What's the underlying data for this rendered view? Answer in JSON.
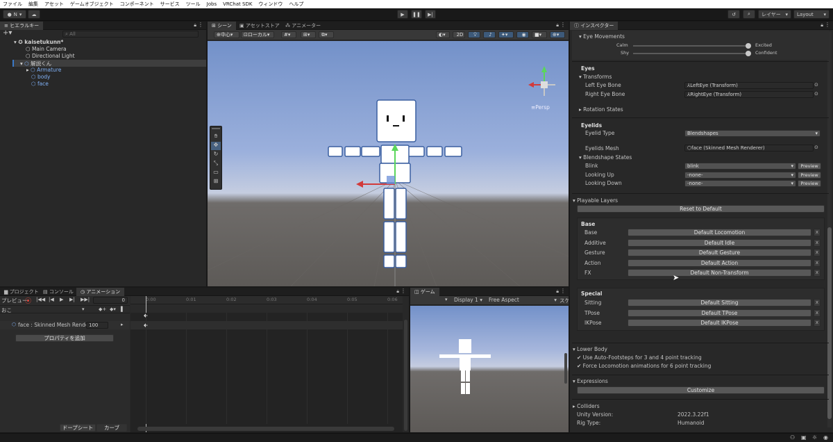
{
  "menubar": {
    "items": [
      "ファイル",
      "編集",
      "アセット",
      "ゲームオブジェクト",
      "コンポーネント",
      "サービス",
      "ツール",
      "Jobs",
      "VRChat SDK",
      "ウィンドウ",
      "ヘルプ"
    ]
  },
  "toolbar": {
    "account_label": "N",
    "layers_label": "レイヤー",
    "layout_label": "Layout"
  },
  "hierarchy": {
    "tab": "ヒエラルキー",
    "search_placeholder": "All",
    "items": [
      "kaisetukunn*",
      "Main Camera",
      "Directional Light",
      "解説くん",
      "Armature",
      "body",
      "face"
    ]
  },
  "scene": {
    "tabs": [
      "シーン",
      "アセットストア",
      "アニメーター"
    ],
    "pivot_label": "中心",
    "space_label": "ローカル",
    "mode_2d": "2D",
    "persp_label": "Persp"
  },
  "animation": {
    "tabs": [
      "プロジェクト",
      "コンソール",
      "アニメーション"
    ],
    "preview_label": "プレビュー",
    "frame_value": "0",
    "clip_name": "おこ",
    "property_label": "face : Skinned Mesh Rende",
    "property_value": "100",
    "add_property_label": "プロパティを追加",
    "ruler": [
      "0:00",
      "0:01",
      "0:02",
      "0:03",
      "0:04",
      "0:05",
      "0:06"
    ],
    "dopesheet_label": "ドープシート",
    "curves_label": "カーブ"
  },
  "game": {
    "tab": "ゲーム",
    "display_label": "Display 1",
    "aspect_label": "Free Aspect",
    "scale_label": "スケ"
  },
  "inspector": {
    "tab": "インスペクター",
    "eye_movements_label": "Eye Movements",
    "sliders": [
      {
        "left": "Calm",
        "right": "Excited",
        "value": 1.0
      },
      {
        "left": "Shy",
        "right": "Confident",
        "value": 1.0
      }
    ],
    "eyes_header": "Eyes",
    "transforms_label": "Transforms",
    "left_eye_label": "Left Eye Bone",
    "left_eye_value": "LeftEye (Transform)",
    "right_eye_label": "Right Eye Bone",
    "right_eye_value": "RightEye (Transform)",
    "rotation_states_label": "Rotation States",
    "eyelids_header": "Eyelids",
    "eyelid_type_label": "Eyelid Type",
    "eyelid_type_value": "Blendshapes",
    "eyelids_mesh_label": "Eyelids Mesh",
    "eyelids_mesh_value": "face (Skinned Mesh Renderer)",
    "blendshape_states_label": "Blendshape States",
    "blend_rows": [
      {
        "label": "Blink",
        "value": "blink",
        "button": "Preview"
      },
      {
        "label": "Looking Up",
        "value": "-none-",
        "button": "Preview"
      },
      {
        "label": "Looking Down",
        "value": "-none-",
        "button": "Preview"
      }
    ],
    "playable_layers_label": "Playable Layers",
    "reset_label": "Reset to Default",
    "base_header": "Base",
    "base_layers": [
      {
        "label": "Base",
        "value": "Default Locomotion"
      },
      {
        "label": "Additive",
        "value": "Default Idle"
      },
      {
        "label": "Gesture",
        "value": "Default Gesture"
      },
      {
        "label": "Action",
        "value": "Default Action"
      },
      {
        "label": "FX",
        "value": "Default Non-Transform"
      }
    ],
    "special_header": "Special",
    "special_layers": [
      {
        "label": "Sitting",
        "value": "Default Sitting"
      },
      {
        "label": "TPose",
        "value": "Default TPose"
      },
      {
        "label": "IKPose",
        "value": "Default IKPose"
      }
    ],
    "x_label": "x",
    "lower_body_label": "Lower Body",
    "check1_label": "Use Auto-Footsteps for 3 and 4 point tracking",
    "check2_label": "Force Locomotion animations for 6 point tracking",
    "expressions_label": "Expressions",
    "customize_label": "Customize",
    "colliders_label": "Colliders",
    "unity_version_label": "Unity Version:",
    "unity_version_value": "2022.3.22f1",
    "rig_type_label": "Rig Type:",
    "rig_type_value": "Humanoid"
  },
  "colors": {
    "accent": "#3a79c8",
    "selection": "#2c5d87",
    "sky_top": "#6f8fc9",
    "ground": "#5e5b58"
  }
}
